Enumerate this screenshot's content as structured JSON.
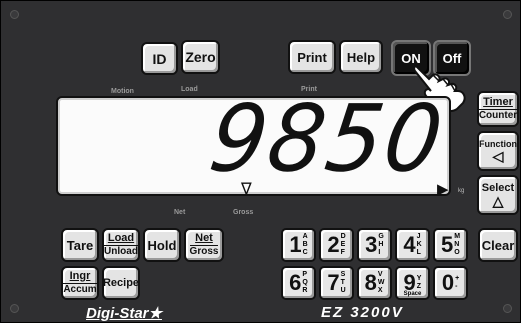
{
  "top_buttons": {
    "id": "ID",
    "zero": "Zero",
    "print": "Print",
    "help": "Help",
    "on": "ON",
    "off": "Off"
  },
  "annunciators": {
    "motion": "Motion",
    "load": "Load",
    "print": "Print",
    "net": "Net",
    "gross": "Gross",
    "kg": "kg"
  },
  "display": {
    "reading": "9850",
    "left_marker": "∇",
    "right_marker": "▶"
  },
  "side_buttons": {
    "timer_line1": "Timer",
    "timer_line2": "Counter",
    "function_label": "Function",
    "function_symbol": "◁",
    "select_label": "Select",
    "select_symbol": "△"
  },
  "left_keys": {
    "tare": "Tare",
    "load_line1": "Load",
    "load_line2": "Unload",
    "hold": "Hold",
    "net_line1": "Net",
    "net_line2": "Gross",
    "ingr_line1": "Ingr",
    "ingr_line2": "Accum",
    "recipe": "Recipe"
  },
  "numpad": [
    {
      "num": "1",
      "sub": [
        "A",
        "B",
        "C"
      ]
    },
    {
      "num": "2",
      "sub": [
        "D",
        "E",
        "F"
      ]
    },
    {
      "num": "3",
      "sub": [
        "G",
        "H",
        "I"
      ]
    },
    {
      "num": "4",
      "sub": [
        "J",
        "K",
        "L"
      ]
    },
    {
      "num": "5",
      "sub": [
        "M",
        "N",
        "O"
      ]
    },
    {
      "num": "6",
      "sub": [
        "P",
        "Q",
        "R"
      ]
    },
    {
      "num": "7",
      "sub": [
        "S",
        "T",
        "U"
      ]
    },
    {
      "num": "8",
      "sub": [
        "V",
        "W",
        "X"
      ]
    },
    {
      "num": "9",
      "sub": [
        "Y",
        "Z",
        ""
      ]
    },
    {
      "num": "0",
      "sub": [
        "+",
        "-",
        ""
      ]
    }
  ],
  "space_label": "Space",
  "clear": "Clear",
  "footer": {
    "brand": "Digi-Star★",
    "model": "EZ 3200V"
  }
}
